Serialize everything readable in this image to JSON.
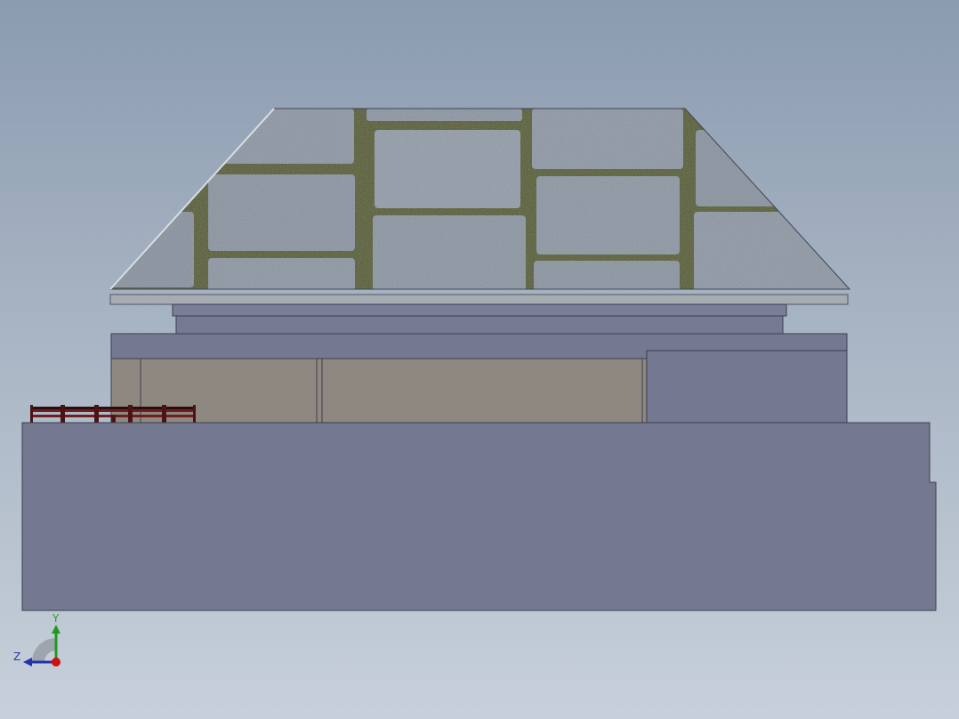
{
  "viewport": {
    "name": "cad-3d-viewport",
    "background_top": "#8b9bb0",
    "background_bottom": "#c7d0da"
  },
  "model": {
    "roof_texture": "cobblestone-paving",
    "colors": {
      "roof_stone": "#8e97a2",
      "roof_joints": "#5e6340",
      "fascia": "#a7acb3",
      "body_slate": "#747890",
      "wall_beige": "#8f8880",
      "railing": "#6e1e1e"
    }
  },
  "triad": {
    "y_label": "Y",
    "z_label": "Z",
    "colors": {
      "y_axis": "#1f9a1f",
      "z_axis": "#2233aa",
      "x_axis": "#cc1111"
    }
  }
}
